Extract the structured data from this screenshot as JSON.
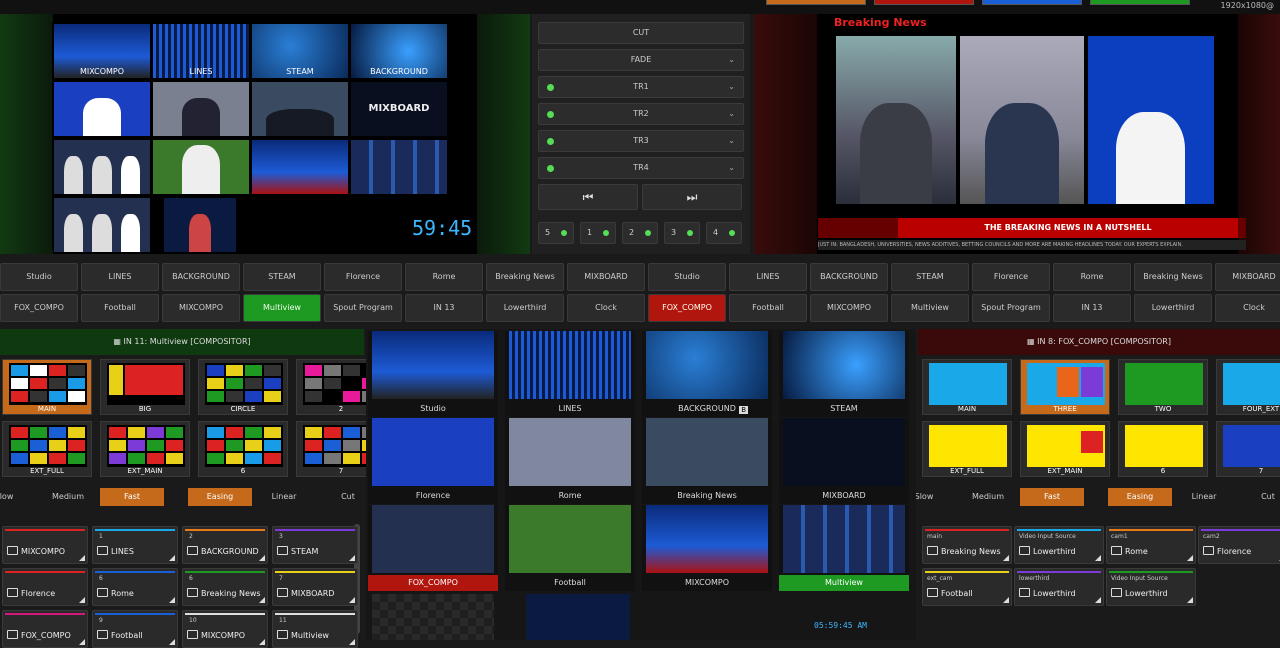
{
  "top": {
    "resolution": "1920x1080@"
  },
  "preview": {
    "multiview_labels": [
      "MIXCOMPO",
      "LINES",
      "STEAM",
      "BACKGROUND"
    ],
    "clock": "59:45"
  },
  "transitions": {
    "buttons": [
      "CUT",
      "FADE",
      "TR1",
      "TR2",
      "TR3",
      "TR4"
    ],
    "numbers": [
      "5",
      "1",
      "2",
      "3",
      "4"
    ]
  },
  "program": {
    "title": "Breaking News",
    "ticker": "THE BREAKING NEWS IN A NUTSHELL",
    "crawl": "JUST IN: BANGLADESH, UNIVERSITIES, NEWS ADDITIVES, BETTING COUNCILS AND MORE ARE MAKING HEADLINES TODAY. OUR EXPERTS EXPLAIN."
  },
  "sources_left": {
    "row1": [
      "Studio",
      "LINES",
      "BACKGROUND",
      "STEAM",
      "Florence",
      "Rome",
      "Breaking News",
      "MIXBOARD"
    ],
    "row2": [
      "FOX_COMPO",
      "Football",
      "MIXCOMPO",
      "Multiview",
      "Spout Program",
      "IN 13",
      "Lowerthird",
      "Clock"
    ]
  },
  "sources_right": {
    "row1": [
      "Studio",
      "LINES",
      "BACKGROUND",
      "STEAM",
      "Florence",
      "Rome",
      "Breaking News",
      "MIXBOARD"
    ],
    "row2": [
      "FOX_COMPO",
      "Football",
      "MIXCOMPO",
      "Multiview",
      "Spout Program",
      "IN 13",
      "Lowerthird",
      "Clock"
    ]
  },
  "left_panel": {
    "title": "IN 11: Multiview [COMPOSITOR]",
    "presets": [
      "MAIN",
      "BIG",
      "CIRCLE",
      "2",
      "EXT_FULL",
      "EXT_MAIN",
      "6",
      "7"
    ],
    "speed": [
      "Slow",
      "Medium",
      "Fast",
      "Easing",
      "Linear",
      "Cut"
    ]
  },
  "right_panel": {
    "title": "IN 8: FOX_COMPO [COMPOSITOR]",
    "presets": [
      "MAIN",
      "THREE",
      "TWO",
      "FOUR_EXT",
      "EXT_FULL",
      "EXT_MAIN",
      "6",
      "7"
    ],
    "speed": [
      "Slow",
      "Medium",
      "Fast",
      "Easing",
      "Linear",
      "Cut"
    ]
  },
  "grid": {
    "tiles": [
      {
        "label": "Studio"
      },
      {
        "label": "LINES"
      },
      {
        "label": "BACKGROUND",
        "badge": "B"
      },
      {
        "label": "STEAM"
      },
      {
        "label": "Florence"
      },
      {
        "label": "Rome"
      },
      {
        "label": "Breaking News"
      },
      {
        "label": "MIXBOARD"
      },
      {
        "label": "FOX_COMPO"
      },
      {
        "label": "Football"
      },
      {
        "label": "MIXCOMPO"
      },
      {
        "label": "Multiview"
      }
    ],
    "bottom_time": "05:59:45 AM"
  },
  "left_sources": [
    {
      "num": "",
      "name": "MIXCOMPO",
      "color": "#d22"
    },
    {
      "num": "1",
      "name": "LINES",
      "color": "#19a9e8"
    },
    {
      "num": "2",
      "name": "BACKGROUND",
      "color": "#e87b19"
    },
    {
      "num": "3",
      "name": "STEAM",
      "color": "#7c3ad6"
    },
    {
      "num": "",
      "name": "Florence",
      "color": "#d22"
    },
    {
      "num": "6",
      "name": "Rome",
      "color": "#1a5fd6"
    },
    {
      "num": "6",
      "name": "Breaking News",
      "color": "#1e9a22"
    },
    {
      "num": "7",
      "name": "MIXBOARD",
      "color": "#e8d019"
    },
    {
      "num": "",
      "name": "FOX_COMPO",
      "color": "#d2197a"
    },
    {
      "num": "9",
      "name": "Football",
      "color": "#1a5fd6"
    },
    {
      "num": "10",
      "name": "MIXCOMPO",
      "color": "#ddd"
    },
    {
      "num": "11",
      "name": "Multiview",
      "color": "#ddd"
    }
  ],
  "right_sources": [
    {
      "sub": "main",
      "name": "Breaking News",
      "color": "#d22"
    },
    {
      "sub": "Video Input Source",
      "name": "Lowerthird",
      "color": "#19a9e8"
    },
    {
      "sub": "cam1",
      "name": "Rome",
      "color": "#e87b19"
    },
    {
      "sub": "cam2",
      "name": "Florence",
      "color": "#7c3ad6"
    },
    {
      "sub": "ext_cam",
      "name": "Football",
      "color": "#e8d019"
    },
    {
      "sub": "lowerthird",
      "name": "Lowerthird",
      "color": "#7c3ad6"
    },
    {
      "sub": "Video Input Source",
      "name": "Lowerthird",
      "color": "#1e9a22"
    }
  ]
}
